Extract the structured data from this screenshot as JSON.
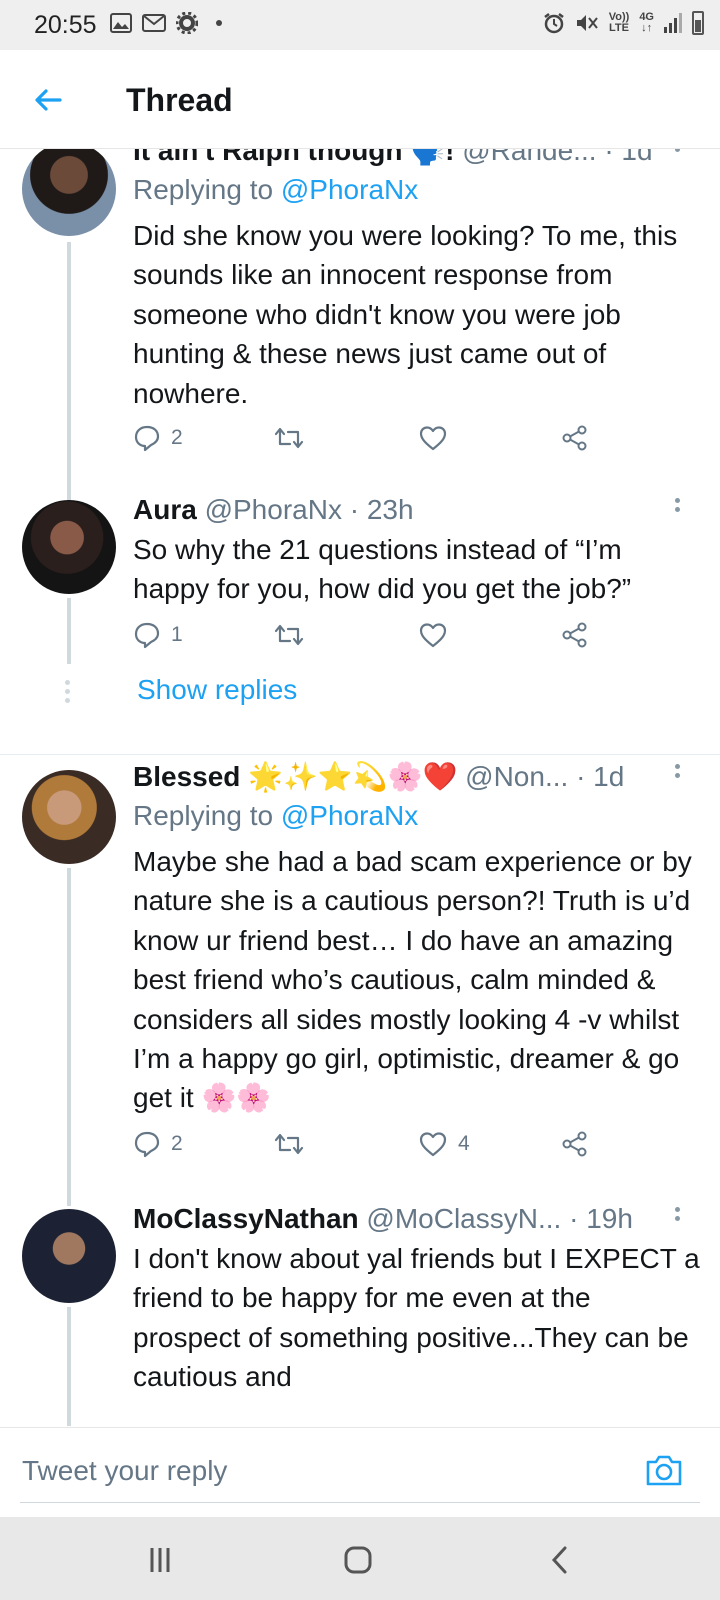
{
  "status_bar": {
    "time": "20:55",
    "left_icons": [
      "gallery-icon",
      "gmail-icon",
      "gear-icon",
      "dot"
    ],
    "right_icons": [
      "alarm-icon",
      "mute-icon",
      "volte-icon",
      "4g-icon",
      "signal-icon",
      "battery-icon"
    ],
    "volte_top": "Vo))",
    "volte_bottom": "LTE",
    "net_top": "4G",
    "net_bottom": "↓↑"
  },
  "header": {
    "title": "Thread"
  },
  "tweets": [
    {
      "name": "It ain't Ralph though 🗣️!",
      "handle": "@Rande...",
      "time": "· 1d",
      "replying_prefix": "Replying to ",
      "replying_to": "@PhoraNx",
      "text": "Did she know you were looking? To me, this sounds like an innocent response from someone who didn't know you were job hunting & these news just came out of nowhere.",
      "replies": "2",
      "retweets": "",
      "likes": ""
    },
    {
      "name": "Aura",
      "handle": "@PhoraNx",
      "time": "· 23h",
      "text": "So why the 21 questions instead of “I’m happy for you, how did you get the job?”",
      "replies": "1",
      "retweets": "",
      "likes": ""
    },
    {
      "name": "Blessed",
      "name_emojis": "🌟✨⭐💫🌸❤️",
      "handle": "@Non...",
      "time": "· 1d",
      "replying_prefix": "Replying to ",
      "replying_to": "@PhoraNx",
      "text": "Maybe she had a bad scam experience or by nature she is a cautious person?! Truth is u’d know ur friend best… I do have an amazing best friend who’s cautious, calm minded & considers all sides mostly looking 4 -v whilst I’m a happy go girl, optimistic, dreamer & go get it 🌸🌸",
      "replies": "2",
      "retweets": "",
      "likes": "4"
    },
    {
      "name": "MoClassyNathan",
      "handle": "@MoClassyN...",
      "time": "· 19h",
      "text": "I don't know about yal friends but I EXPECT a friend to be happy for me even at the prospect of something positive...They can be cautious and"
    }
  ],
  "show_replies": "Show replies",
  "reply_bar": {
    "placeholder": "Tweet your reply"
  },
  "colors": {
    "accent": "#1da1f2",
    "text": "#14171a",
    "secondary": "#657786",
    "heart": "#e0245e"
  },
  "icons": [
    "back-arrow-icon",
    "reply-icon",
    "retweet-icon",
    "like-icon",
    "share-icon",
    "more-icon",
    "camera-icon",
    "recents-icon",
    "home-icon",
    "back-icon"
  ]
}
